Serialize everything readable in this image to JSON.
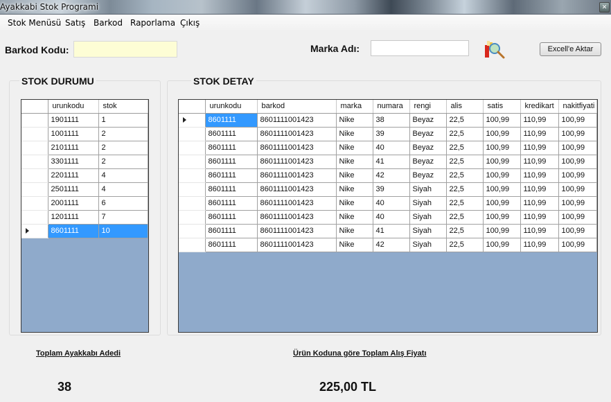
{
  "window": {
    "title": "Ayakkabi Stok Programi",
    "close_glyph": "✕"
  },
  "menu": [
    {
      "label": "Stok Menüsü"
    },
    {
      "label": "Satış"
    },
    {
      "label": "Barkod"
    },
    {
      "label": "Raporlama"
    },
    {
      "label": "Çıkış"
    }
  ],
  "filters": {
    "barcode_label": "Barkod Kodu:",
    "barcode_value": "",
    "brand_label": "Marka Adı:",
    "brand_value": "",
    "search_icon": "search-icon",
    "export_button": "Excell'e Aktar"
  },
  "stock_status": {
    "title": "STOK DURUMU",
    "columns": [
      "urunkodu",
      "stok"
    ],
    "selected_index": 8,
    "rows": [
      [
        "1901111",
        "1"
      ],
      [
        "1001111",
        "2"
      ],
      [
        "2101111",
        "2"
      ],
      [
        "3301111",
        "2"
      ],
      [
        "2201111",
        "4"
      ],
      [
        "2501111",
        "4"
      ],
      [
        "2001111",
        "6"
      ],
      [
        "1201111",
        "7"
      ],
      [
        "8601111",
        "10"
      ]
    ]
  },
  "stock_detail": {
    "title": "STOK DETAY",
    "columns": [
      "urunkodu",
      "barkod",
      "marka",
      "numara",
      "rengi",
      "alis",
      "satis",
      "kredikart",
      "nakitfiyati"
    ],
    "current_row": 0,
    "rows": [
      [
        "8601111",
        "8601111001423",
        "Nike",
        "38",
        "Beyaz",
        "22,5",
        "100,99",
        "110,99",
        "100,99"
      ],
      [
        "8601111",
        "8601111001423",
        "Nike",
        "39",
        "Beyaz",
        "22,5",
        "100,99",
        "110,99",
        "100,99"
      ],
      [
        "8601111",
        "8601111001423",
        "Nike",
        "40",
        "Beyaz",
        "22,5",
        "100,99",
        "110,99",
        "100,99"
      ],
      [
        "8601111",
        "8601111001423",
        "Nike",
        "41",
        "Beyaz",
        "22,5",
        "100,99",
        "110,99",
        "100,99"
      ],
      [
        "8601111",
        "8601111001423",
        "Nike",
        "42",
        "Beyaz",
        "22,5",
        "100,99",
        "110,99",
        "100,99"
      ],
      [
        "8601111",
        "8601111001423",
        "Nike",
        "39",
        "Siyah",
        "22,5",
        "100,99",
        "110,99",
        "100,99"
      ],
      [
        "8601111",
        "8601111001423",
        "Nike",
        "40",
        "Siyah",
        "22,5",
        "100,99",
        "110,99",
        "100,99"
      ],
      [
        "8601111",
        "8601111001423",
        "Nike",
        "40",
        "Siyah",
        "22,5",
        "100,99",
        "110,99",
        "100,99"
      ],
      [
        "8601111",
        "8601111001423",
        "Nike",
        "41",
        "Siyah",
        "22,5",
        "100,99",
        "110,99",
        "100,99"
      ],
      [
        "8601111",
        "8601111001423",
        "Nike",
        "42",
        "Siyah",
        "22,5",
        "100,99",
        "110,99",
        "100,99"
      ]
    ]
  },
  "summary": {
    "total_shoes_label": "Toplam Ayakkabı Adedi",
    "total_shoes_value": "38",
    "total_purchase_label": "Ürün Koduna göre Toplam Alış Fiyatı",
    "total_purchase_value": "225,00 TL"
  },
  "colors": {
    "selection": "#3399ff",
    "grid_background": "#8faacb",
    "barcode_input_bg": "#fdfdd5"
  }
}
